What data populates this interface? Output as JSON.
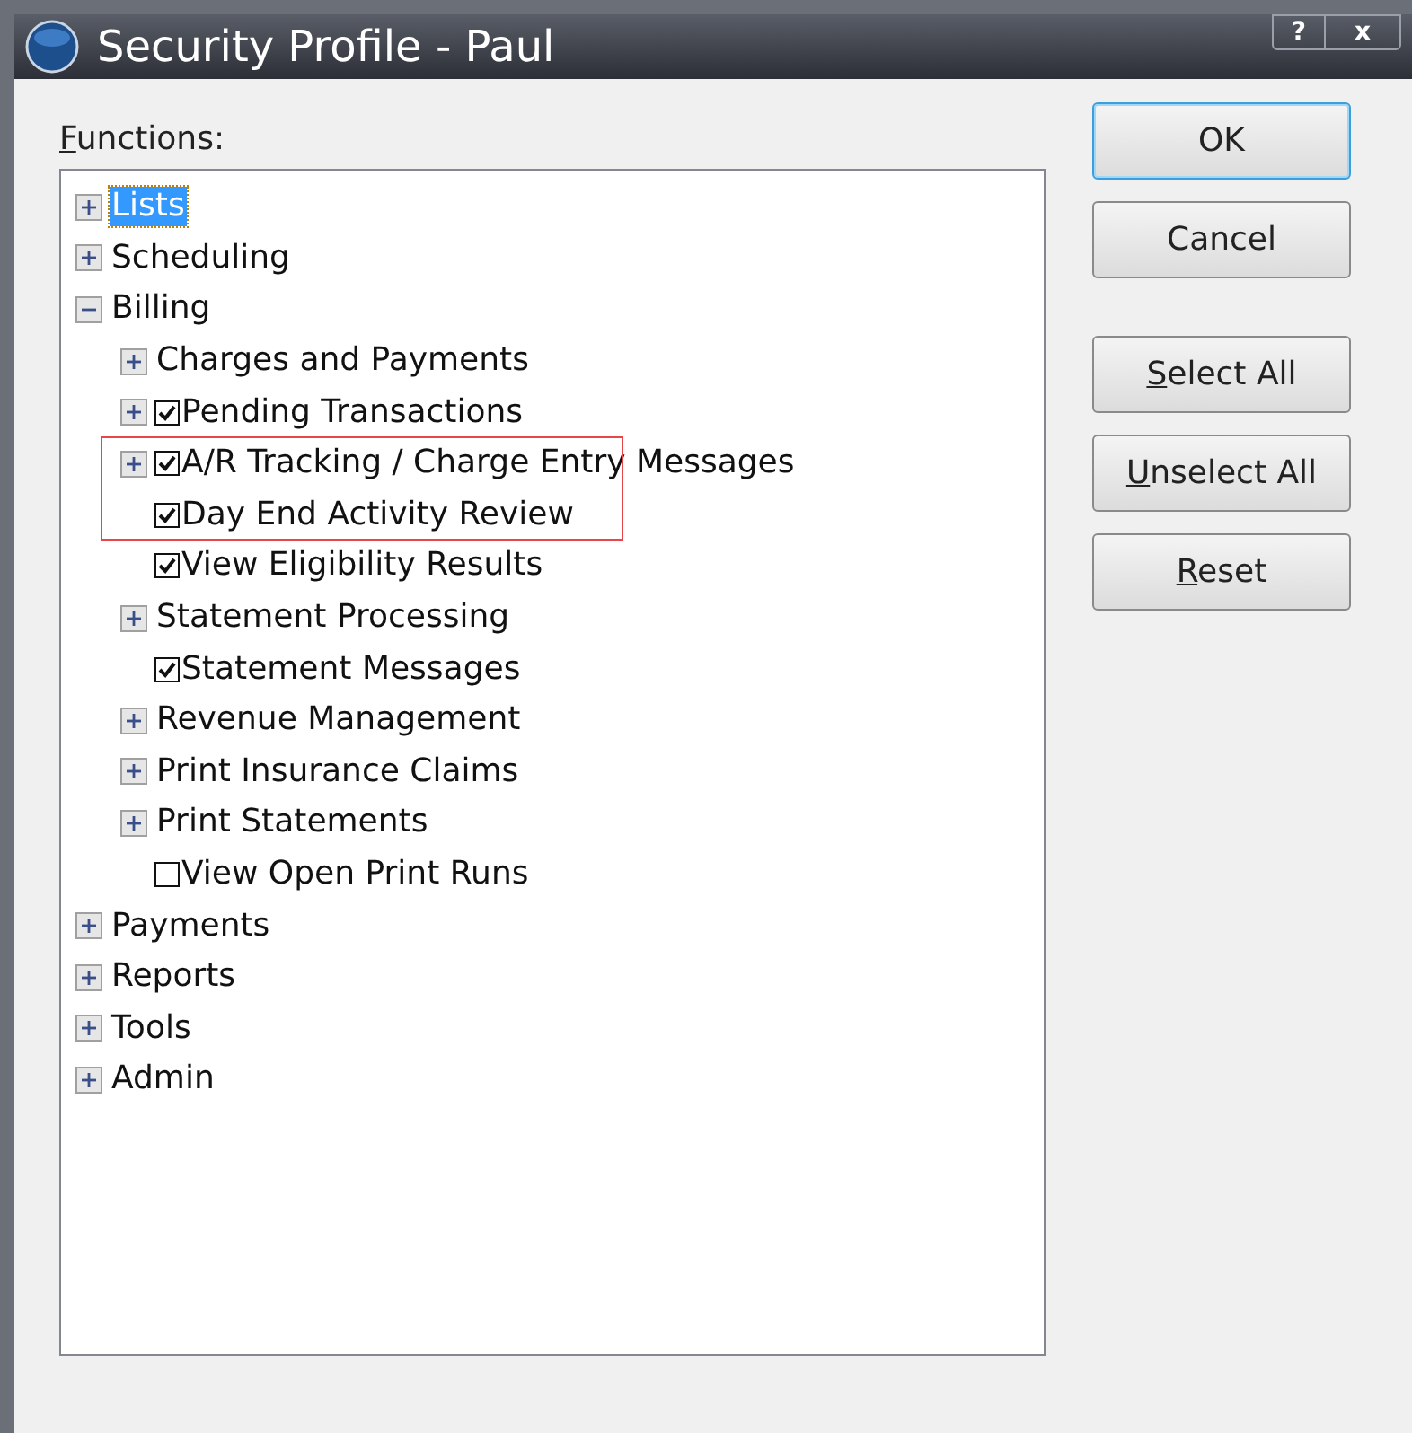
{
  "window": {
    "title": "Security Profile - Paul",
    "controls": [
      "?",
      "x"
    ]
  },
  "functions_label": {
    "text": "Functions:",
    "underline_first": true
  },
  "tree": [
    {
      "label": "Lists",
      "expandable": true,
      "expanded": false,
      "selected": true
    },
    {
      "label": "Scheduling",
      "expandable": true,
      "expanded": false,
      "selected": false
    },
    {
      "label": "Billing",
      "expandable": true,
      "expanded": true,
      "selected": false,
      "children": [
        {
          "label": "Charges and Payments",
          "expandable": true,
          "expanded": false,
          "selected": false
        },
        {
          "label": "Pending Transactions",
          "expandable": true,
          "expanded": false,
          "selected": false,
          "checked": true
        },
        {
          "label": "A/R Tracking / Charge Entry Messages",
          "expandable": true,
          "expanded": false,
          "selected": false,
          "checked": true
        },
        {
          "label": "Day End Activity Review",
          "expandable": false,
          "selected": false,
          "checked": true
        },
        {
          "label": "View Eligibility Results",
          "expandable": false,
          "selected": false,
          "checked": true
        },
        {
          "label": "Statement Processing",
          "expandable": true,
          "expanded": false,
          "selected": false
        },
        {
          "label": "Statement Messages",
          "expandable": false,
          "selected": false,
          "checked": true
        },
        {
          "label": "Revenue Management",
          "expandable": true,
          "expanded": false,
          "selected": false
        },
        {
          "label": "Print Insurance Claims",
          "expandable": true,
          "expanded": false,
          "selected": false
        },
        {
          "label": "Print Statements",
          "expandable": true,
          "expanded": false,
          "selected": false
        },
        {
          "label": "View Open Print Runs",
          "expandable": false,
          "selected": false,
          "checked": false
        }
      ]
    },
    {
      "label": "Payments",
      "expandable": true,
      "expanded": false,
      "selected": false
    },
    {
      "label": "Reports",
      "expandable": true,
      "expanded": false,
      "selected": false
    },
    {
      "label": "Tools",
      "expandable": true,
      "expanded": false,
      "selected": false
    },
    {
      "label": "Admin",
      "expandable": true,
      "expanded": false,
      "selected": false
    }
  ],
  "highlight": {
    "color": "#e8474a"
  },
  "buttons": [
    {
      "label": "OK",
      "underline_first": false,
      "default": true
    },
    {
      "label": "Cancel",
      "underline_first": false,
      "default": false
    },
    {
      "label": "Select All",
      "underline_first": true,
      "default": false
    },
    {
      "label": "Unselect All",
      "underline_first": true,
      "default": false
    },
    {
      "label": "Reset",
      "underline_first": true,
      "default": false
    }
  ]
}
